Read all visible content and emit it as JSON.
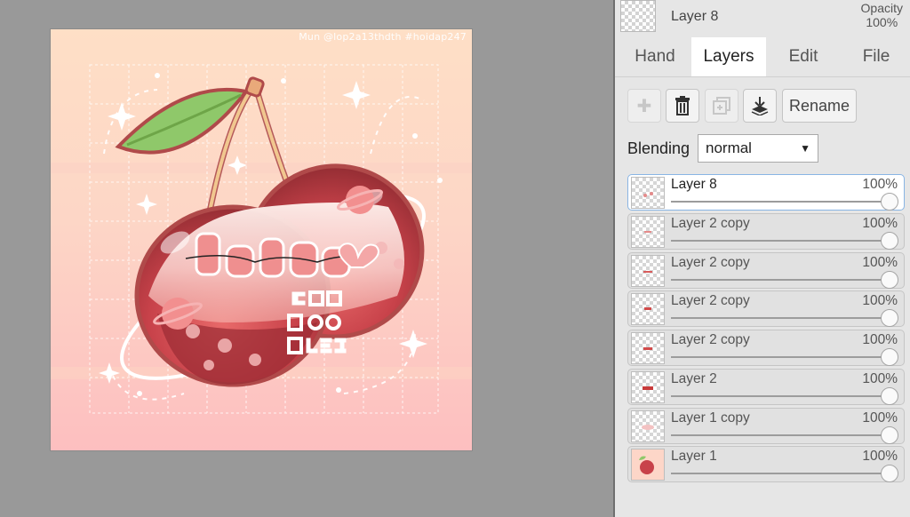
{
  "watermark": "Mun @lop2a13thdth #hoidap247",
  "current_layer": {
    "name": "Layer 8",
    "opacity_label": "Opacity",
    "opacity_value": "100%"
  },
  "tabs": [
    {
      "label": "Hand",
      "active": false
    },
    {
      "label": "Layers",
      "active": true
    },
    {
      "label": "Edit",
      "active": false
    },
    {
      "label": "File",
      "active": false
    }
  ],
  "toolbar": {
    "add_icon": "plus-icon",
    "delete_icon": "trash-icon",
    "duplicate_icon": "duplicate-icon",
    "merge_icon": "merge-down-icon",
    "rename_label": "Rename"
  },
  "blending": {
    "label": "Blending",
    "value": "normal"
  },
  "layers": [
    {
      "name": "Layer 8",
      "opacity": "100%",
      "active": true
    },
    {
      "name": "Layer 2 copy",
      "opacity": "100%",
      "active": false
    },
    {
      "name": "Layer 2 copy",
      "opacity": "100%",
      "active": false
    },
    {
      "name": "Layer 2 copy",
      "opacity": "100%",
      "active": false
    },
    {
      "name": "Layer 2 copy",
      "opacity": "100%",
      "active": false
    },
    {
      "name": "Layer 2",
      "opacity": "100%",
      "active": false
    },
    {
      "name": "Layer 1 copy",
      "opacity": "100%",
      "active": false
    },
    {
      "name": "Layer 1",
      "opacity": "100%",
      "active": false
    }
  ],
  "colors": {
    "panel_bg": "#e6e6e6",
    "workspace_bg": "#999999",
    "active_tab_bg": "#ffffff",
    "active_layer_border": "#89b5e4",
    "cherry_red": "#c8424a",
    "leaf_green": "#8fc86a"
  }
}
